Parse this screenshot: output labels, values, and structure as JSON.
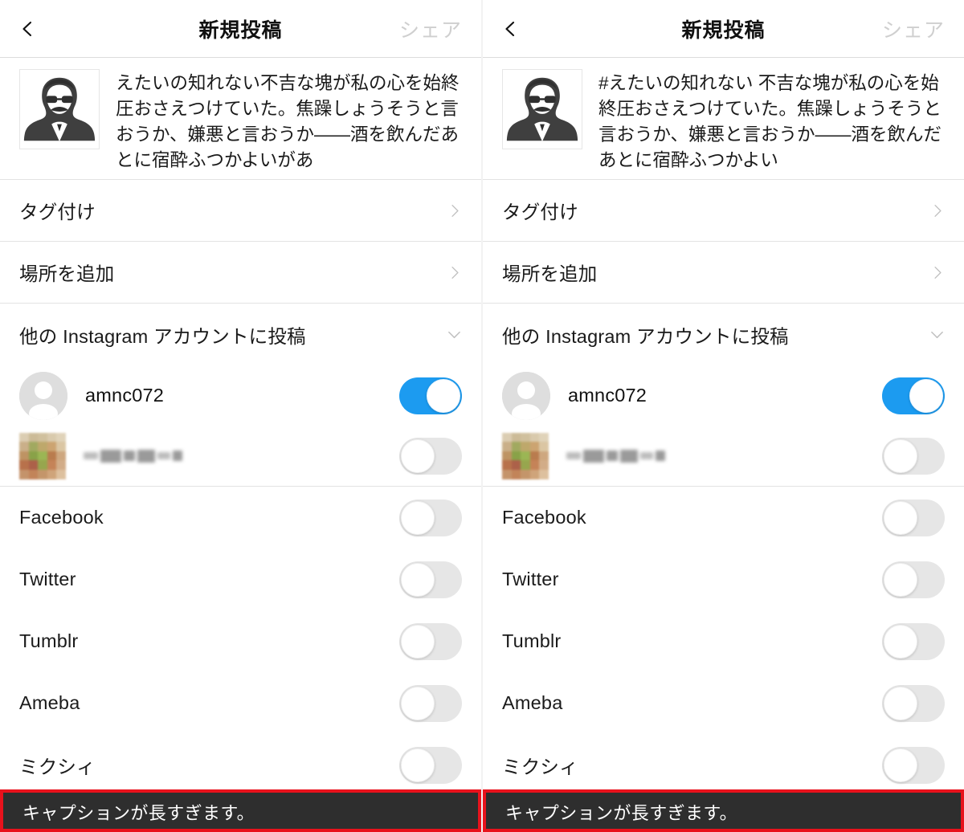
{
  "header": {
    "back_icon": "chevron-left-icon",
    "title": "新規投稿",
    "share_label": "シェア"
  },
  "panels": {
    "left": {
      "caption": "えたいの知れない不吉な塊が私の心を始終圧おさえつけていた。焦躁しょうそうと言おうか、嫌悪と言おうか——酒を飲んだあとに宿酔ふつかよいがあ"
    },
    "right": {
      "caption": "#えたいの知れない 不吉な塊が私の心を始終圧おさえつけていた。焦躁しょうそうと言おうか、嫌悪と言おうか——酒を飲んだあとに宿酔ふつかよい"
    }
  },
  "rows": {
    "tag_people": "タグ付け",
    "add_location": "場所を追加",
    "other_accounts": "他の Instagram アカウントに投稿"
  },
  "accounts": [
    {
      "name": "amnc072",
      "avatar": "default-avatar-icon",
      "enabled": true
    },
    {
      "name": "",
      "avatar": "blurred-photo-avatar",
      "blurred": true,
      "enabled": false
    }
  ],
  "social": [
    {
      "label": "Facebook",
      "enabled": false
    },
    {
      "label": "Twitter",
      "enabled": false
    },
    {
      "label": "Tumblr",
      "enabled": false
    },
    {
      "label": "Ameba",
      "enabled": false
    },
    {
      "label": "ミクシィ",
      "enabled": false
    }
  ],
  "toast": {
    "message": "キャプションが長すぎます。"
  },
  "colors": {
    "toggle_on": "#1c9bf0",
    "toggle_off": "#e6e6e6",
    "toast_bg": "#2e2e2e",
    "toast_border": "#e8121c",
    "share_disabled": "#cfcfcf",
    "divider": "#e3e3e3"
  },
  "icons": {
    "chevron_right": "chevron-right-icon",
    "chevron_down": "chevron-down-icon"
  }
}
